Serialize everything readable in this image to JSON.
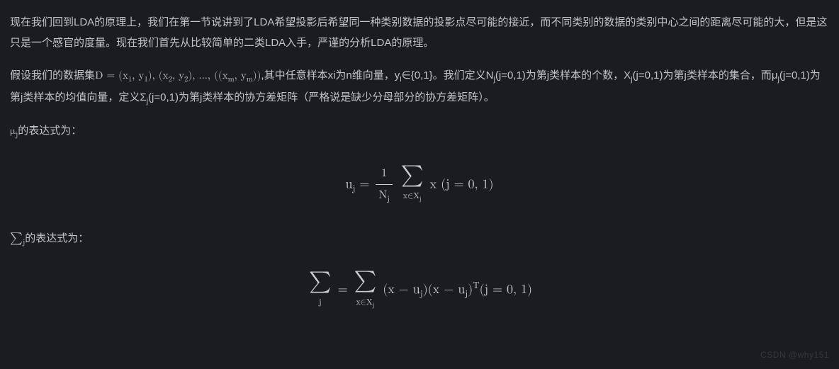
{
  "para1": {
    "text": "现在我们回到LDA的原理上，我们在第一节说讲到了LDA希望投影后希望同一种类别数据的投影点尽可能的接近，而不同类别的数据的类别中心之间的距离尽可能的大，但是这只是一个感官的度量。现在我们首先从比较简单的二类LDA入手，严谨的分析LDA的原理。"
  },
  "para2": {
    "pre": "假设我们的数据集",
    "D": "D",
    "eq": " = ",
    "set_open": "(x",
    "c1": ", y",
    "close1": "), (x",
    "c2": ", y",
    "close2": "), ..., ((x",
    "cm": ", y",
    "close_m": "))",
    "post1": ",其中任意样本xi为n维向量，y",
    "post1b": "∈{0,1}。我们定义N",
    "post2": "(j=0,1)为第j类样本的个数，X",
    "post3": "(j=0,1)为第j类样本的集合，而μ",
    "post4": "(j=0,1)为第j类样本的均值向量，定义Σ",
    "post5": "(j=0,1)为第j类样本的协方差矩阵（严格说是缺少分母部分的协方差矩阵）。"
  },
  "para3": {
    "pre": "μ",
    "post": "的表达式为："
  },
  "formula1": {
    "u": "u",
    "eq": " = ",
    "num": "1",
    "N": "N",
    "x": "x",
    "xsub": "x∈X",
    "cond": "  (j = 0, 1)"
  },
  "para4": {
    "pre": "∑",
    "post": "的表达式为："
  },
  "formula2": {
    "eq": " = ",
    "xsub": "x∈X",
    "open": "(x − u",
    "mid": ")(x − u",
    "close": ")",
    "T": "T",
    "cond": "(j = 0, 1)"
  },
  "subs": {
    "j": "j",
    "i": "i",
    "1": "1",
    "2": "2",
    "m": "m"
  },
  "watermark": "CSDN @why151"
}
